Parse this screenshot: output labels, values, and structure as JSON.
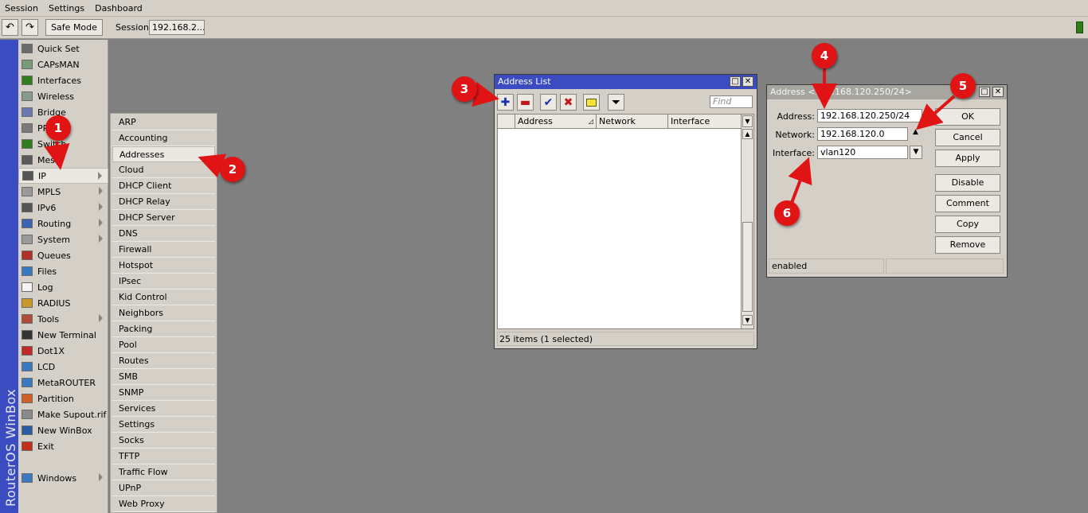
{
  "menubar": [
    "Session",
    "Settings",
    "Dashboard"
  ],
  "toolbar": {
    "undo_icon": "undo-icon",
    "redo_icon": "redo-icon",
    "safe_mode": "Safe Mode",
    "session_label": "Session:",
    "session_value": "192.168.2..."
  },
  "brand": "RouterOS WinBox",
  "sidebar": {
    "items": [
      {
        "label": "Quick Set",
        "icon": "quick-set-icon",
        "color": "#6b6b6b"
      },
      {
        "label": "CAPsMAN",
        "icon": "capsman-icon",
        "color": "#7a9a7a"
      },
      {
        "label": "Interfaces",
        "icon": "interfaces-icon",
        "color": "#2f7d1e"
      },
      {
        "label": "Wireless",
        "icon": "wireless-icon",
        "color": "#8a9a8a"
      },
      {
        "label": "Bridge",
        "icon": "bridge-icon",
        "color": "#6a7ab0"
      },
      {
        "label": "PPP",
        "icon": "ppp-icon",
        "color": "#7a7a7a"
      },
      {
        "label": "Switch",
        "icon": "switch-icon",
        "color": "#2f7d1e"
      },
      {
        "label": "Mesh",
        "icon": "mesh-icon",
        "color": "#5a5a5a"
      },
      {
        "label": "IP",
        "icon": "ip-icon",
        "color": "#555555",
        "arrow": true,
        "selected": true
      },
      {
        "label": "MPLS",
        "icon": "mpls-icon",
        "color": "#9a9a9a",
        "arrow": true
      },
      {
        "label": "IPv6",
        "icon": "ipv6-icon",
        "color": "#555555",
        "arrow": true
      },
      {
        "label": "Routing",
        "icon": "routing-icon",
        "color": "#3a64b0",
        "arrow": true
      },
      {
        "label": "System",
        "icon": "system-icon",
        "color": "#9a9a9a",
        "arrow": true
      },
      {
        "label": "Queues",
        "icon": "queues-icon",
        "color": "#b0302a"
      },
      {
        "label": "Files",
        "icon": "files-icon",
        "color": "#3a78c0"
      },
      {
        "label": "Log",
        "icon": "log-icon",
        "color": "#f4f4f4"
      },
      {
        "label": "RADIUS",
        "icon": "radius-icon",
        "color": "#c89a2a"
      },
      {
        "label": "Tools",
        "icon": "tools-icon",
        "color": "#b04a3a",
        "arrow": true
      },
      {
        "label": "New Terminal",
        "icon": "terminal-icon",
        "color": "#333333"
      },
      {
        "label": "Dot1X",
        "icon": "dot1x-icon",
        "color": "#c02a2a"
      },
      {
        "label": "LCD",
        "icon": "lcd-icon",
        "color": "#3a78c0"
      },
      {
        "label": "MetaROUTER",
        "icon": "metarouter-icon",
        "color": "#3a78c0"
      },
      {
        "label": "Partition",
        "icon": "partition-icon",
        "color": "#d0602a"
      },
      {
        "label": "Make Supout.rif",
        "icon": "supout-icon",
        "color": "#8a8a8a"
      },
      {
        "label": "New WinBox",
        "icon": "winbox-icon",
        "color": "#2a5aa0"
      },
      {
        "label": "Exit",
        "icon": "exit-icon",
        "color": "#c0301a"
      }
    ],
    "windows": {
      "label": "Windows",
      "icon": "windows-icon",
      "color": "#3a78c0"
    }
  },
  "submenu": [
    "ARP",
    "Accounting",
    "Addresses",
    "Cloud",
    "DHCP Client",
    "DHCP Relay",
    "DHCP Server",
    "DNS",
    "Firewall",
    "Hotspot",
    "IPsec",
    "Kid Control",
    "Neighbors",
    "Packing",
    "Pool",
    "Routes",
    "SMB",
    "SNMP",
    "Services",
    "Settings",
    "Socks",
    "TFTP",
    "Traffic Flow",
    "UPnP",
    "Web Proxy"
  ],
  "address_list": {
    "title": "Address List",
    "find_placeholder": "Find",
    "columns": [
      "Address",
      "Network",
      "Interface"
    ],
    "status": "25 items (1 selected)"
  },
  "address_dialog": {
    "title": "Address <192.168.120.250/24>",
    "address_label": "Address:",
    "address_value": "192.168.120.250/24",
    "network_label": "Network:",
    "network_value": "192.168.120.0",
    "interface_label": "Interface:",
    "interface_value": "vlan120",
    "buttons": [
      "OK",
      "Cancel",
      "Apply",
      "Disable",
      "Comment",
      "Copy",
      "Remove"
    ],
    "status": "enabled"
  },
  "callouts": [
    "1",
    "2",
    "3",
    "4",
    "5",
    "6"
  ],
  "colors": {
    "title_active": "#3b4cc0",
    "title_inactive": "#a7a5a0",
    "callout": "#e01414",
    "panel": "#d4d0c8"
  }
}
